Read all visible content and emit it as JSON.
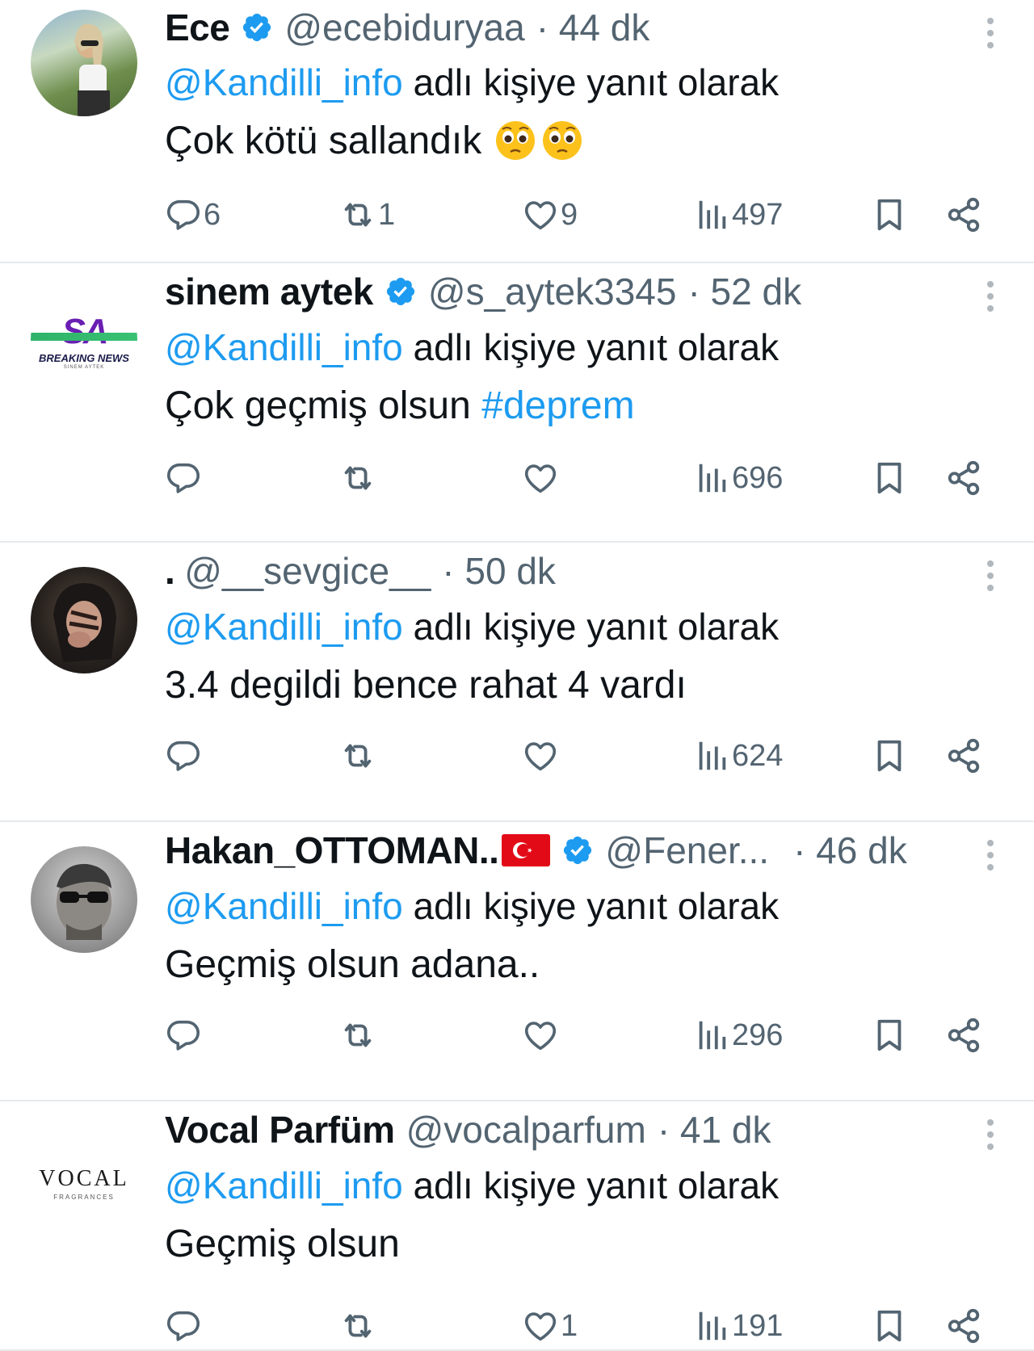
{
  "colors": {
    "accent": "#1d9bf0",
    "muted": "#536471",
    "text": "#0f1419",
    "divider": "#e6e9ec"
  },
  "icons": [
    "verified-badge-icon",
    "reply-icon",
    "retweet-icon",
    "like-icon",
    "views-icon",
    "bookmark-icon",
    "share-icon",
    "more-icon",
    "pleading-face-emoji",
    "turkey-flag-icon"
  ],
  "tweets": [
    {
      "name": "Ece",
      "handle": "@ecebiduryaa",
      "time": "· 44 dk",
      "reply_mention": "@Kandilli_info",
      "reply_suffix": " adlı kişiye yanıt olarak",
      "text": "Çok kötü sallandık",
      "replies": "6",
      "retweets": "1",
      "likes": "9",
      "views": "497"
    },
    {
      "name": "sinem aytek",
      "handle": "@s_aytek3345",
      "time": "· 52 dk",
      "avatar_text": "SA",
      "avatar_sub": "BREAKING NEWS",
      "avatar_sub2": "SINEM AYTEK",
      "reply_mention": "@Kandilli_info",
      "reply_suffix": " adlı kişiye yanıt olarak",
      "text": "Çok geçmiş olsun ",
      "hashtag": "#deprem",
      "replies": "",
      "retweets": "",
      "likes": "",
      "views": "696"
    },
    {
      "name": ".",
      "handle": "@__sevgice__",
      "time": "· 50 dk",
      "reply_mention": "@Kandilli_info",
      "reply_suffix": " adlı kişiye yanıt olarak",
      "text": "3.4 degildi bence rahat 4 vardı",
      "replies": "",
      "retweets": "",
      "likes": "",
      "views": "624"
    },
    {
      "name": "Hakan_OTTOMAN..",
      "handle": "@Fener...",
      "time": "· 46 dk",
      "reply_mention": "@Kandilli_info",
      "reply_suffix": " adlı kişiye yanıt olarak",
      "text": "Geçmiş olsun adana..",
      "replies": "",
      "retweets": "",
      "likes": "",
      "views": "296"
    },
    {
      "name": "Vocal Parfüm",
      "handle": "@vocalparfum",
      "time": "· 41 dk",
      "avatar_text": "VOCAL",
      "avatar_sub": "FRAGRANCES",
      "reply_mention": "@Kandilli_info",
      "reply_suffix": " adlı kişiye yanıt olarak",
      "text": "Geçmiş olsun",
      "replies": "",
      "retweets": "",
      "likes": "1",
      "views": "191"
    }
  ]
}
